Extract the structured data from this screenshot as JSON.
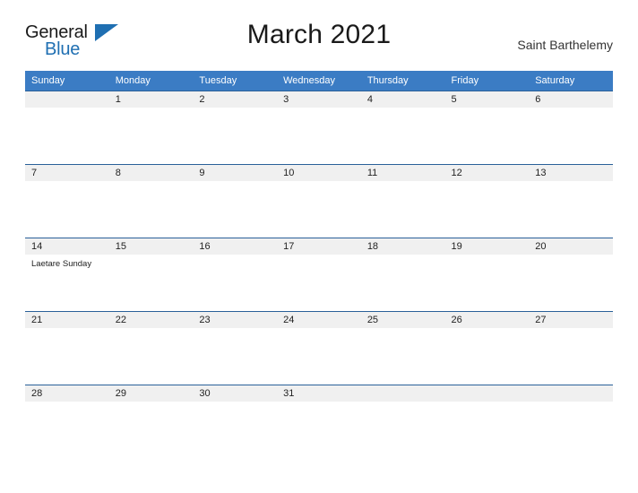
{
  "brand": {
    "name_top": "General",
    "name_bottom": "Blue",
    "triangle_color": "#1f6fb2"
  },
  "header": {
    "title": "March 2021",
    "location": "Saint Barthelemy"
  },
  "colors": {
    "header_blue": "#3b7cc4",
    "rule_blue": "#2a6099",
    "day_band": "#f0f0f0",
    "page_background": "#ffffff"
  },
  "calendar": {
    "weekday_headers": [
      "Sunday",
      "Monday",
      "Tuesday",
      "Wednesday",
      "Thursday",
      "Friday",
      "Saturday"
    ],
    "weeks": [
      [
        {
          "day": "",
          "event": ""
        },
        {
          "day": "1",
          "event": ""
        },
        {
          "day": "2",
          "event": ""
        },
        {
          "day": "3",
          "event": ""
        },
        {
          "day": "4",
          "event": ""
        },
        {
          "day": "5",
          "event": ""
        },
        {
          "day": "6",
          "event": ""
        }
      ],
      [
        {
          "day": "7",
          "event": ""
        },
        {
          "day": "8",
          "event": ""
        },
        {
          "day": "9",
          "event": ""
        },
        {
          "day": "10",
          "event": ""
        },
        {
          "day": "11",
          "event": ""
        },
        {
          "day": "12",
          "event": ""
        },
        {
          "day": "13",
          "event": ""
        }
      ],
      [
        {
          "day": "14",
          "event": "Laetare Sunday"
        },
        {
          "day": "15",
          "event": ""
        },
        {
          "day": "16",
          "event": ""
        },
        {
          "day": "17",
          "event": ""
        },
        {
          "day": "18",
          "event": ""
        },
        {
          "day": "19",
          "event": ""
        },
        {
          "day": "20",
          "event": ""
        }
      ],
      [
        {
          "day": "21",
          "event": ""
        },
        {
          "day": "22",
          "event": ""
        },
        {
          "day": "23",
          "event": ""
        },
        {
          "day": "24",
          "event": ""
        },
        {
          "day": "25",
          "event": ""
        },
        {
          "day": "26",
          "event": ""
        },
        {
          "day": "27",
          "event": ""
        }
      ],
      [
        {
          "day": "28",
          "event": ""
        },
        {
          "day": "29",
          "event": ""
        },
        {
          "day": "30",
          "event": ""
        },
        {
          "day": "31",
          "event": ""
        },
        {
          "day": "",
          "event": ""
        },
        {
          "day": "",
          "event": ""
        },
        {
          "day": "",
          "event": ""
        }
      ]
    ]
  }
}
